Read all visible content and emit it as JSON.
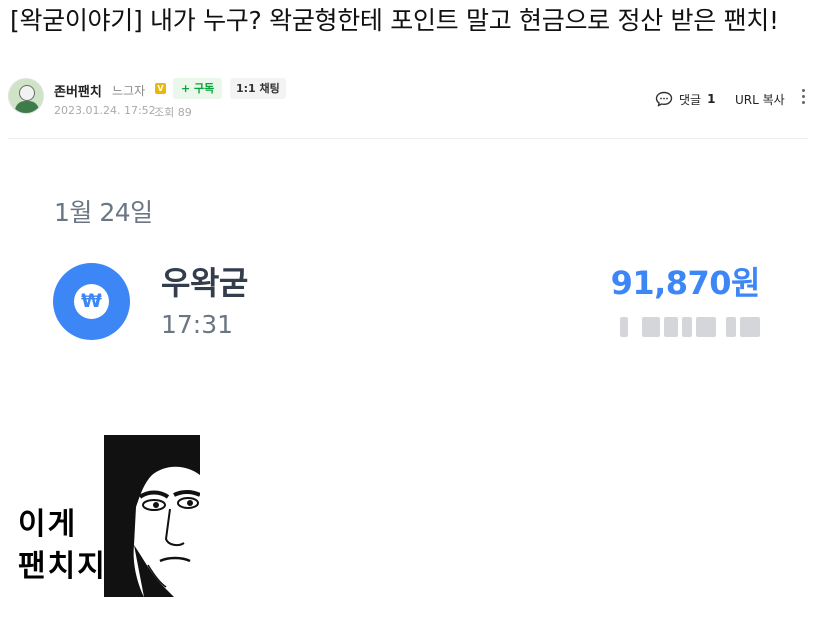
{
  "post": {
    "title": "[왁굳이야기] 내가 누구? 왁굳형한테 포인트 말고 현금으로 정산 받은 팬치!",
    "author": "존버팬치",
    "grade": "느그자",
    "grade_badge": "V",
    "subscribe_label": "+ 구독",
    "chat_label": "1:1 채팅",
    "date": "2023.01.24. 17:52",
    "views": "조회 89",
    "comment_label": "댓글",
    "comment_count": "1",
    "url_copy_label": "URL 복사"
  },
  "receipt": {
    "date": "1월 24일",
    "icon_symbol": "₩",
    "sender": "우왁굳",
    "time": "17:31",
    "amount": "91,870원",
    "accent_color": "#3d86f5"
  },
  "meme": {
    "line1": "이게",
    "line2": "팬치지"
  }
}
